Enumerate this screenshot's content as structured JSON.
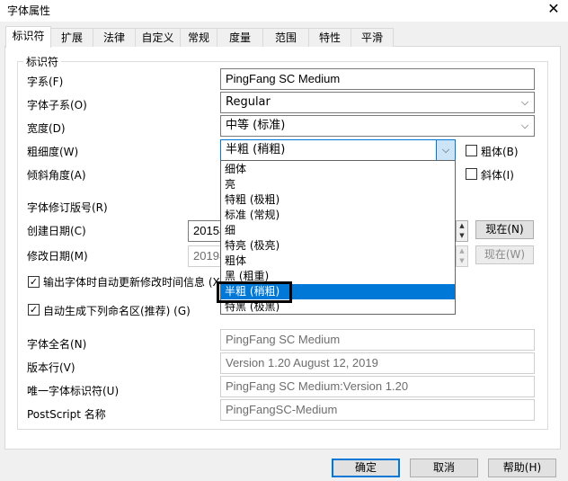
{
  "window": {
    "title": "字体属性",
    "close_glyph": "✕"
  },
  "tabs": [
    "标识符",
    "扩展",
    "法律",
    "自定义",
    "常规",
    "度量",
    "范围",
    "特性",
    "平滑"
  ],
  "group": {
    "title": "标识符"
  },
  "fields": {
    "family": {
      "label": "字系(F)",
      "value": "PingFang SC Medium"
    },
    "subfamily": {
      "label": "字体子系(O)",
      "value": "Regular"
    },
    "width": {
      "label": "宽度(D)",
      "value": "中等 (标准)"
    },
    "weight": {
      "label": "粗细度(W)",
      "value": "半粗 (稍粗)"
    },
    "italic_angle": {
      "label": "倾斜角度(A)"
    },
    "revision": {
      "label": "字体修订版号(R)"
    },
    "created": {
      "label": "创建日期(C)",
      "value": "2015年"
    },
    "modified": {
      "label": "修改日期(M)",
      "value": "2019年"
    },
    "auto_update": {
      "label": "输出字体时自动更新修改时间信息 (X)",
      "checked": true
    },
    "auto_names": {
      "label": "自动生成下列命名区(推荐) (G)",
      "checked": true
    },
    "full_name": {
      "label": "字体全名(N)",
      "value": "PingFang SC Medium"
    },
    "version": {
      "label": "版本行(V)",
      "value": "Version 1.20 August 12, 2019"
    },
    "unique_id": {
      "label": "唯一字体标识符(U)",
      "value": "PingFang SC Medium:Version 1.20"
    },
    "postscript": {
      "label": "PostScript 名称",
      "value": "PingFangSC-Medium"
    }
  },
  "checks": {
    "bold": {
      "label": "粗体(B)",
      "checked": false
    },
    "italic": {
      "label": "斜体(I)",
      "checked": false
    }
  },
  "weight_options": [
    "细体",
    "亮",
    "特粗 (极粗)",
    "标准 (常规)",
    "细",
    "特亮 (极亮)",
    "粗体",
    "黑 (粗重)",
    "半粗 (稍粗)",
    "特黑 (极黑)"
  ],
  "weight_selected": "半粗 (稍粗)",
  "now_buttons": {
    "created": "现在(N)",
    "modified": "现在(W)"
  },
  "footer": {
    "ok": "确定",
    "cancel": "取消",
    "help": "帮助(H)"
  },
  "icons": {
    "combo_arrow": "chevron-down-icon",
    "check": "✓",
    "spin_up": "▲",
    "spin_down": "▼"
  },
  "colors": {
    "accent": "#0078d7",
    "selection": "#0078d7",
    "window_bg": "#f0f0f0"
  }
}
